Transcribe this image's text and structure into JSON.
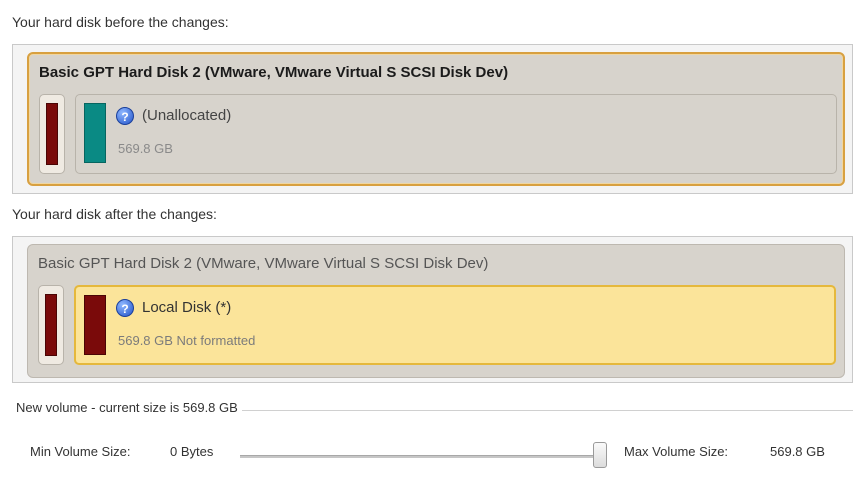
{
  "before": {
    "label": "Your hard disk before the changes:",
    "disk_title": "Basic GPT Hard Disk 2 (VMware, VMware Virtual S SCSI Disk Dev)",
    "partition": {
      "name": "(Unallocated)",
      "size": "569.8 GB",
      "icon": "help-icon",
      "swatch_color": "#0a8a84"
    }
  },
  "after": {
    "label": "Your hard disk after the changes:",
    "disk_title": "Basic GPT Hard Disk 2 (VMware, VMware Virtual S SCSI Disk Dev)",
    "partition": {
      "name": "Local Disk (*)",
      "size": "569.8 GB Not formatted",
      "icon": "help-icon",
      "swatch_color": "#7a0a0a"
    }
  },
  "volume": {
    "legend": "New volume - current size is 569.8 GB",
    "min_label": "Min Volume Size:",
    "min_value": "0 Bytes",
    "max_label": "Max Volume Size:",
    "max_value": "569.8 GB",
    "slider_fraction": 1.0
  }
}
